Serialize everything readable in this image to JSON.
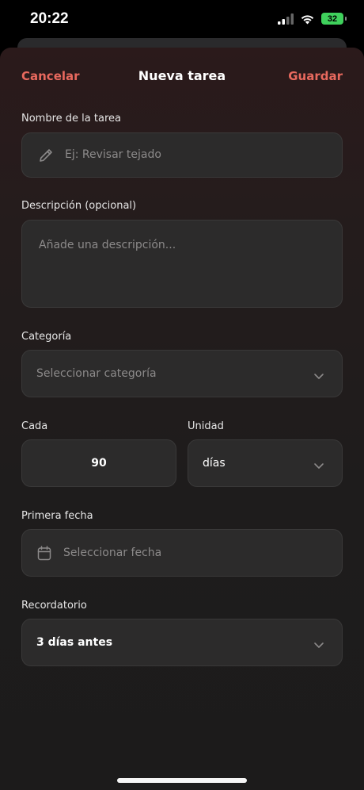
{
  "status": {
    "time": "20:22",
    "battery": "32"
  },
  "nav": {
    "cancel": "Cancelar",
    "title": "Nueva tarea",
    "save": "Guardar"
  },
  "form": {
    "name": {
      "label": "Nombre de la tarea",
      "placeholder": "Ej: Revisar tejado",
      "icon": "pencil-icon"
    },
    "description": {
      "label": "Descripción (opcional)",
      "placeholder": "Añade una descripción..."
    },
    "category": {
      "label": "Categoría",
      "placeholder": "Seleccionar categoría",
      "icon": "chevron-down-icon"
    },
    "every": {
      "label": "Cada",
      "value": "90"
    },
    "unit": {
      "label": "Unidad",
      "value": "días",
      "icon": "chevron-down-icon"
    },
    "first_date": {
      "label": "Primera fecha",
      "placeholder": "Seleccionar fecha",
      "icon": "calendar-icon"
    },
    "reminder": {
      "label": "Recordatorio",
      "value": "3 días antes",
      "icon": "chevron-down-icon"
    }
  },
  "colors": {
    "accent": "#e8695e",
    "field_bg": "#2c2b2b",
    "battery": "#3fd15c"
  }
}
